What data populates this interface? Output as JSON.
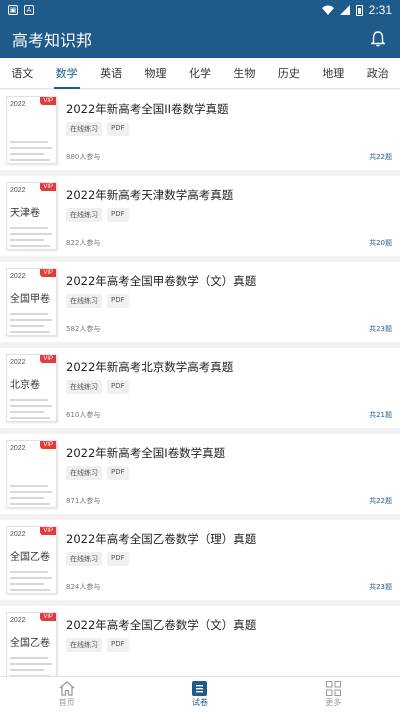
{
  "status_bar": {
    "time": "2:31",
    "left_icons": [
      "image-icon",
      "a-icon"
    ],
    "right_icons": [
      "wifi-icon",
      "signal-icon",
      "battery-icon"
    ]
  },
  "app": {
    "title": "高考知识邦",
    "accent": "#1e5a8a"
  },
  "tabs": [
    {
      "label": "语文",
      "active": false
    },
    {
      "label": "数学",
      "active": true
    },
    {
      "label": "英语",
      "active": false
    },
    {
      "label": "物理",
      "active": false
    },
    {
      "label": "化学",
      "active": false
    },
    {
      "label": "生物",
      "active": false
    },
    {
      "label": "历史",
      "active": false
    },
    {
      "label": "地理",
      "active": false
    },
    {
      "label": "政治",
      "active": false
    }
  ],
  "papers": [
    {
      "thumb_year": "2022",
      "thumb_region": "",
      "vip": "VIP",
      "title": "2022年新高考全国II卷数学真题",
      "tags": [
        "在线练习",
        "PDF"
      ],
      "participants": "880人参与",
      "count": "共22题"
    },
    {
      "thumb_year": "2022",
      "thumb_region": "天津卷",
      "vip": "VIP",
      "title": "2022年新高考天津数学高考真题",
      "tags": [
        "在线练习",
        "PDF"
      ],
      "participants": "822人参与",
      "count": "共20题"
    },
    {
      "thumb_year": "2022",
      "thumb_region": "全国甲卷",
      "vip": "VIP",
      "title": "2022年高考全国甲卷数学（文）真题",
      "tags": [
        "在线练习",
        "PDF"
      ],
      "participants": "582人参与",
      "count": "共23题"
    },
    {
      "thumb_year": "2022",
      "thumb_region": "北京卷",
      "vip": "VIP",
      "title": "2022年新高考北京数学高考真题",
      "tags": [
        "在线练习",
        "PDF"
      ],
      "participants": "610人参与",
      "count": "共21题"
    },
    {
      "thumb_year": "2022",
      "thumb_region": "",
      "vip": "VIP",
      "title": "2022年新高考全国I卷数学真题",
      "tags": [
        "在线练习",
        "PDF"
      ],
      "participants": "871人参与",
      "count": "共22题"
    },
    {
      "thumb_year": "2022",
      "thumb_region": "全国乙卷",
      "vip": "VIP",
      "title": "2022年高考全国乙卷数学（理）真题",
      "tags": [
        "在线练习",
        "PDF"
      ],
      "participants": "824人参与",
      "count": "共23题"
    },
    {
      "thumb_year": "2022",
      "thumb_region": "全国乙卷",
      "vip": "VIP",
      "title": "2022年高考全国乙卷数学（文）真题",
      "tags": [
        "在线练习",
        "PDF"
      ],
      "participants": "",
      "count": ""
    }
  ],
  "bottom_nav": [
    {
      "label": "首页",
      "icon": "home-icon",
      "active": false
    },
    {
      "label": "试卷",
      "icon": "paper-list-icon",
      "active": true
    },
    {
      "label": "更多",
      "icon": "grid-icon",
      "active": false
    }
  ]
}
